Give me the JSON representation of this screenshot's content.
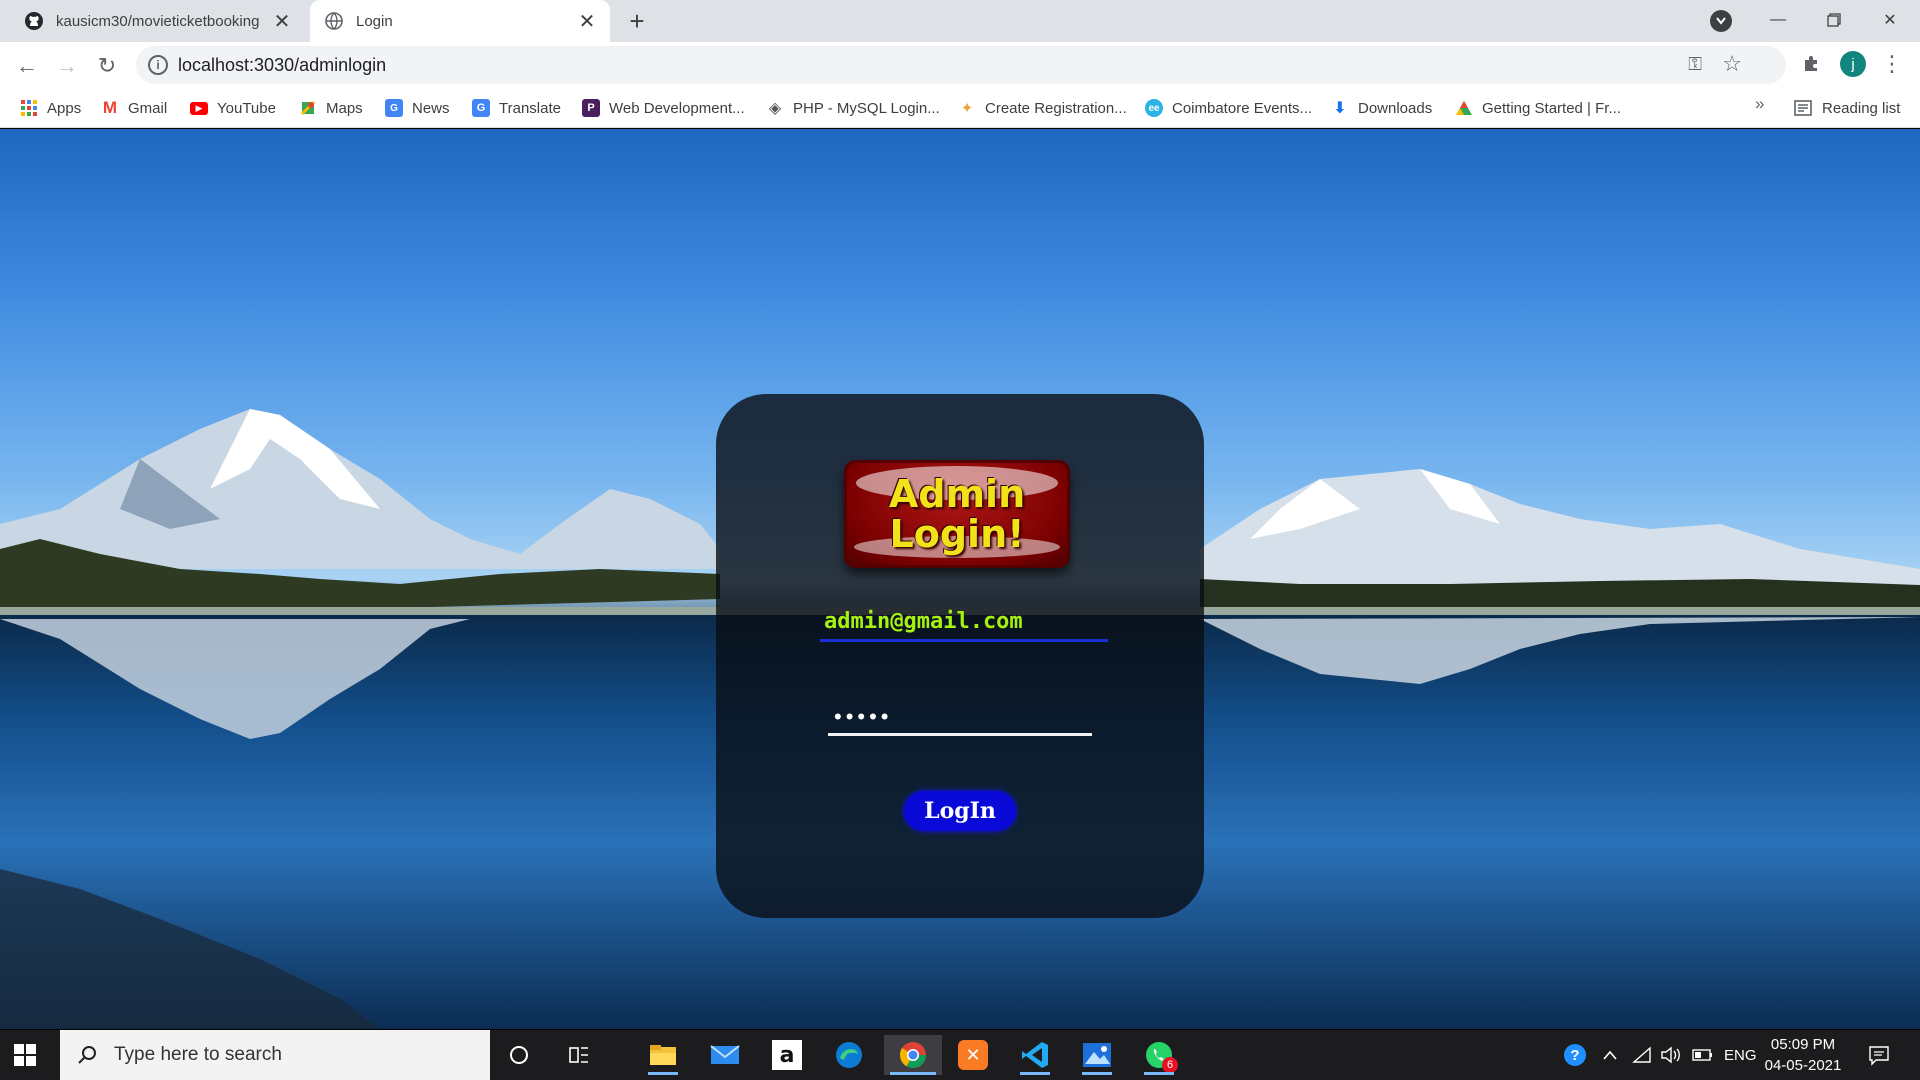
{
  "browser": {
    "tabs": [
      {
        "title": "kausicm30/movieticketbooking",
        "icon": "github-icon",
        "active": false
      },
      {
        "title": "Login",
        "icon": "globe-icon",
        "active": true
      }
    ],
    "new_tab_label": "+",
    "url": "localhost:3030/adminlogin",
    "profile_initial": "j",
    "profile_color": "#12857f"
  },
  "bookmarks": {
    "items": [
      {
        "label": "Apps",
        "icon": "apps-grid-icon"
      },
      {
        "label": "Gmail",
        "icon": "gmail-icon"
      },
      {
        "label": "YouTube",
        "icon": "youtube-icon"
      },
      {
        "label": "Maps",
        "icon": "maps-icon"
      },
      {
        "label": "News",
        "icon": "news-icon"
      },
      {
        "label": "Translate",
        "icon": "translate-icon"
      },
      {
        "label": "Web Development...",
        "icon": "bookmark-p-icon"
      },
      {
        "label": "PHP - MySQL Login...",
        "icon": "diamond-icon"
      },
      {
        "label": "Create Registration...",
        "icon": "code-icon"
      },
      {
        "label": "Coimbatore Events...",
        "icon": "events-icon"
      },
      {
        "label": "Downloads",
        "icon": "download-icon"
      },
      {
        "label": "Getting Started | Fr...",
        "icon": "triangle-icon"
      }
    ],
    "overflow_label": "»",
    "reading_list_label": "Reading list"
  },
  "login": {
    "logo_line1": "Admin",
    "logo_line2": "Login!",
    "email_value": "admin@gmail.com",
    "password_value": "•••••",
    "button_label": "LogIn",
    "colors": {
      "email_text": "#a6f20f",
      "email_underline": "#1a2fd6",
      "button_bg": "#0a0ad8",
      "logo_text": "#f2e21a",
      "logo_bg": "#7a0000"
    }
  },
  "taskbar": {
    "search_placeholder": "Type here to search",
    "apps": [
      "cortana-icon",
      "task-view-icon",
      "file-explorer-icon",
      "mail-icon",
      "amazon-icon",
      "edge-icon",
      "chrome-icon",
      "xampp-icon",
      "vscode-icon",
      "photos-icon",
      "whatsapp-icon"
    ],
    "whatsapp_badge": "6",
    "language": "ENG",
    "time": "05:09 PM",
    "date": "04-05-2021"
  }
}
